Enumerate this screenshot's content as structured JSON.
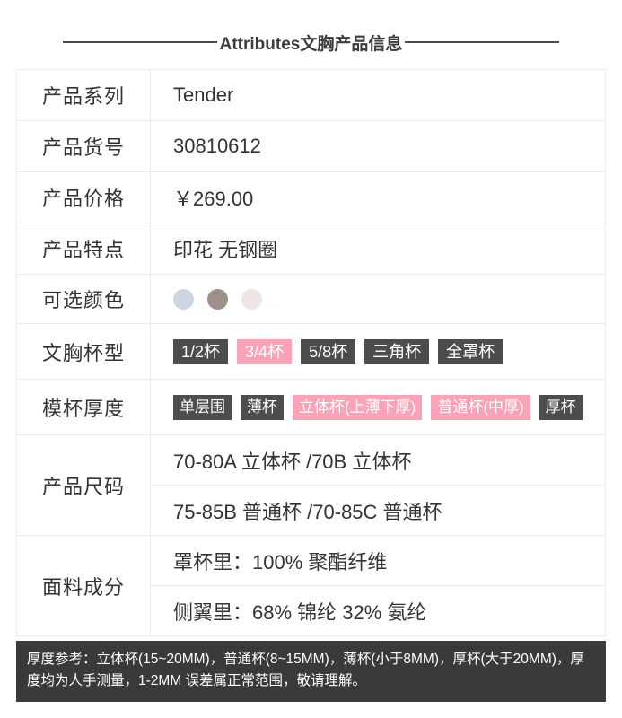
{
  "header": {
    "title": "Attributes文胸产品信息"
  },
  "table": {
    "rows": [
      {
        "label": "产品系列",
        "value": "Tender"
      },
      {
        "label": "产品货号",
        "value": "30810612"
      },
      {
        "label": "产品价格",
        "value": "￥269.00"
      },
      {
        "label": "产品特点",
        "value": "印花 无钢圈"
      },
      {
        "label": "可选颜色"
      },
      {
        "label": "文胸杯型"
      },
      {
        "label": "模杯厚度"
      },
      {
        "label": "产品尺码",
        "line1": "70-80A 立体杯 /70B 立体杯",
        "line2": "75-85B 普通杯 /70-85C 普通杯"
      },
      {
        "label": "面料成分",
        "line1": "罩杯里：100% 聚酯纤维",
        "line2": "侧翼里：68% 锦纶 32% 氨纶"
      }
    ]
  },
  "colors": {
    "label": "可选颜色",
    "swatches": [
      {
        "name": "ice-blue",
        "hex": "#ccd5e0"
      },
      {
        "name": "taupe",
        "hex": "#9c9089"
      },
      {
        "name": "pale-pink",
        "hex": "#f0e5e5"
      }
    ]
  },
  "cup_type": {
    "label": "文胸杯型",
    "options": [
      {
        "text": "1/2杯",
        "selected": false
      },
      {
        "text": "3/4杯",
        "selected": true
      },
      {
        "text": "5/8杯",
        "selected": false
      },
      {
        "text": "三角杯",
        "selected": false
      },
      {
        "text": "全罩杯",
        "selected": false
      }
    ]
  },
  "cup_thickness": {
    "label": "模杯厚度",
    "options": [
      {
        "text": "单层围",
        "selected": false
      },
      {
        "text": "薄杯",
        "selected": false
      },
      {
        "text": "立体杯(上薄下厚)",
        "selected": true
      },
      {
        "text": "普通杯(中厚)",
        "selected": true
      },
      {
        "text": "厚杯",
        "selected": false
      }
    ]
  },
  "footer": {
    "note": "厚度参考：立体杯(15~20MM)，普通杯(8~15MM)，薄杯(小于8MM)，厚杯(大于20MM)，厚度均为人手测量，1-2MM 误差属正常范围，敬请理解。"
  },
  "theme": {
    "tag_dark": "#4d4d4d",
    "tag_pink": "#f9a3b8",
    "border": "#ececec",
    "footer_bg": "#3a3a3a",
    "text": "#333333"
  }
}
